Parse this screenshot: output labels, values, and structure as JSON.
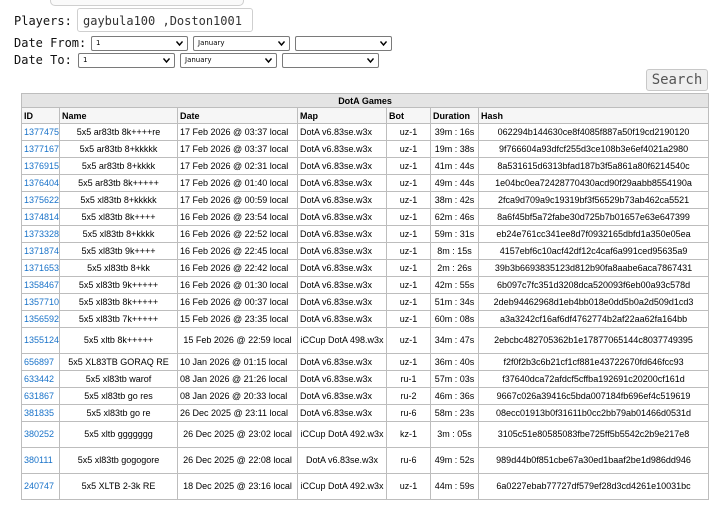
{
  "filters": {
    "players_label": "Players:",
    "players_value": "gaybula100 ,Doston1001",
    "date_from_label": "Date From:",
    "date_to_label": "Date To:",
    "from": {
      "day": "1",
      "month": "January",
      "year": ""
    },
    "to": {
      "day": "1",
      "month": "January",
      "year": ""
    }
  },
  "search_label": "Search",
  "table": {
    "caption": "DotA Games",
    "headers": [
      "ID",
      "Name",
      "Date",
      "Map",
      "Bot",
      "Duration",
      "Hash"
    ],
    "rows": [
      {
        "id": "1377475",
        "name": "5x5 ar83tb 8k++++re",
        "date": "17 Feb 2026 @ 03:37 local",
        "map": "DotA v6.83se.w3x",
        "bot": "uz-1",
        "duration": "39m : 16s",
        "hash": "062294b144630ce8f4085f887a50f19cd2190120"
      },
      {
        "id": "1377167",
        "name": "5x5 ar83tb 8+kkkkk",
        "date": "17 Feb 2026 @ 03:37 local",
        "map": "DotA v6.83se.w3x",
        "bot": "uz-1",
        "duration": "19m : 38s",
        "hash": "9f766604a93dfcf255d3ce108b3e6ef4021a2980"
      },
      {
        "id": "1376915",
        "name": "5x5 ar83tb 8+kkkk",
        "date": "17 Feb 2026 @ 02:31 local",
        "map": "DotA v6.83se.w3x",
        "bot": "uz-1",
        "duration": "41m : 44s",
        "hash": "8a531615d6313bfad187b3f5a861a80f6214540c"
      },
      {
        "id": "1376404",
        "name": "5x5 ar83tb 8k+++++",
        "date": "17 Feb 2026 @ 01:40 local",
        "map": "DotA v6.83se.w3x",
        "bot": "uz-1",
        "duration": "49m : 44s",
        "hash": "1e04bc0ea72428770430acd90f29aabb8554190a"
      },
      {
        "id": "1375622",
        "name": "5x5 xl83tb 8+kkkkk",
        "date": "17 Feb 2026 @ 00:59 local",
        "map": "DotA v6.83se.w3x",
        "bot": "uz-1",
        "duration": "38m : 42s",
        "hash": "2fca9d709a9c19319bf3f56529b73ab462ca5521"
      },
      {
        "id": "1374814",
        "name": "5x5 xl83tb 8k++++",
        "date": "16 Feb 2026 @ 23:54 local",
        "map": "DotA v6.83se.w3x",
        "bot": "uz-1",
        "duration": "62m : 46s",
        "hash": "8a6f45bf5a72fabe30d725b7b01657e63e647399"
      },
      {
        "id": "1373328",
        "name": "5x5 xl83tb 8+kkkk",
        "date": "16 Feb 2026 @ 22:52 local",
        "map": "DotA v6.83se.w3x",
        "bot": "uz-1",
        "duration": "59m : 31s",
        "hash": "eb24e761cc341ee8d7f0932165dbfd1a350e05ea"
      },
      {
        "id": "1371874",
        "name": "5x5 xl83tb 9k++++",
        "date": "16 Feb 2026 @ 22:45 local",
        "map": "DotA v6.83se.w3x",
        "bot": "uz-1",
        "duration": "8m : 15s",
        "hash": "4157ebf6c10acf42df12c4caf6a991ced95635a9"
      },
      {
        "id": "1371653",
        "name": "5x5 xl83tb 8+kk",
        "date": "16 Feb 2026 @ 22:42 local",
        "map": "DotA v6.83se.w3x",
        "bot": "uz-1",
        "duration": "2m : 26s",
        "hash": "39b3b6693835123d812b90fa8aabe6aca7867431"
      },
      {
        "id": "1358467",
        "name": "5x5 xl83tb 9k+++++",
        "date": "16 Feb 2026 @ 01:30 local",
        "map": "DotA v6.83se.w3x",
        "bot": "uz-1",
        "duration": "42m : 55s",
        "hash": "6b097c7fc351d3208dca520093f6eb00a93c578d"
      },
      {
        "id": "1357710",
        "name": "5x5 xl83tb 8k+++++",
        "date": "16 Feb 2026 @ 00:37 local",
        "map": "DotA v6.83se.w3x",
        "bot": "uz-1",
        "duration": "51m : 34s",
        "hash": "2deb94462968d1eb4bb018e0dd5b0a2d509d1cd3"
      },
      {
        "id": "1356592",
        "name": "5x5 xl83tb 7k+++++",
        "date": "15 Feb 2026 @ 23:35 local",
        "map": "DotA v6.83se.w3x",
        "bot": "uz-1",
        "duration": "60m : 08s",
        "hash": "a3a3242cf16af6df4762774b2af22aa62fa164bb"
      },
      {
        "id": "1355124",
        "name": "5x5 xltb 8k+++++",
        "date": "15 Feb 2026 @ 22:59 local",
        "map": "iCCup DotA 498.w3x",
        "bot": "uz-1",
        "duration": "34m : 47s",
        "hash": "2ebcbc482705362b1e17877065144c8037749395",
        "tall": true
      },
      {
        "id": "656897",
        "name": "5x5 XL83TB GORAQ RE",
        "date": "10 Jan 2026 @ 01:15 local",
        "map": "DotA v6.83se.w3x",
        "bot": "uz-1",
        "duration": "36m : 40s",
        "hash": "f2f0f2b3c6b21cf1cf881e43722670fd646fcc93"
      },
      {
        "id": "633442",
        "name": "5x5 xl83tb warof",
        "date": "08 Jan 2026 @ 21:26 local",
        "map": "DotA v6.83se.w3x",
        "bot": "ru-1",
        "duration": "57m : 03s",
        "hash": "f37640dca72afdcf5cffba192691c20200cf161d"
      },
      {
        "id": "631867",
        "name": "5x5 xl83tb go res",
        "date": "08 Jan 2026 @ 20:33 local",
        "map": "DotA v6.83se.w3x",
        "bot": "ru-2",
        "duration": "46m : 36s",
        "hash": "9667c026a39416c5bda007184fb696ef4c519619"
      },
      {
        "id": "381835",
        "name": "5x5 xl83tb go re",
        "date": "26 Dec 2025 @ 23:11 local",
        "map": "DotA v6.83se.w3x",
        "bot": "ru-6",
        "duration": "58m : 23s",
        "hash": "08ecc01913b0f31611b0cc2bb79ab01466d0531d"
      },
      {
        "id": "380252",
        "name": "5x5 xltb ggggggg",
        "date": "26 Dec 2025 @ 23:02 local",
        "map": "iCCup DotA 492.w3x",
        "bot": "kz-1",
        "duration": "3m : 05s",
        "hash": "3105c51e80585083fbe725ff5b5542c2b9e217e8",
        "tall": true
      },
      {
        "id": "380111",
        "name": "5x5 xl83tb gogogore",
        "date": "26 Dec 2025 @ 22:08 local",
        "map": "DotA v6.83se.w3x",
        "bot": "ru-6",
        "duration": "49m : 52s",
        "hash": "989d44b0f851cbe67a30ed1baaf2be1d986dd946",
        "tall": true
      },
      {
        "id": "240747",
        "name": "5x5 XLTB 2-3k RE",
        "date": "18 Dec 2025 @ 23:16 local",
        "map": "iCCup DotA 492.w3x",
        "bot": "uz-1",
        "duration": "44m : 59s",
        "hash": "6a0227ebab77727df579ef28d3cd4261e10031bc",
        "tall": true
      }
    ]
  }
}
